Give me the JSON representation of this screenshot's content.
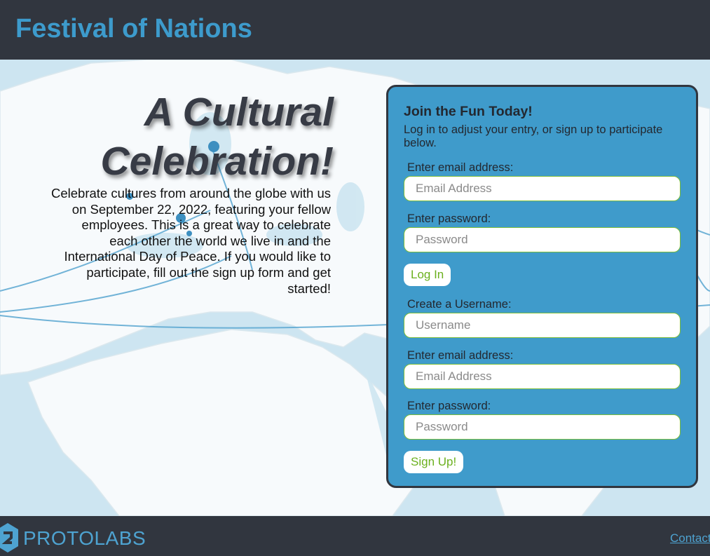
{
  "header": {
    "title": "Festival of Nations"
  },
  "hero": {
    "headline_line1": "A Cultural",
    "headline_line2": "Celebration!",
    "intro": "Celebrate cultures from around the globe with us on September 22, 2022, featuring your fellow employees. This is a great way to celebrate each other the world we live in and the International Day of Peace. If you would like to participate, fill out the sign up form and get started!"
  },
  "panel": {
    "title": "Join the Fun Today!",
    "subtitle": "Log in to adjust your entry, or sign up to participate below.",
    "login": {
      "email_label": "Enter email address:",
      "email_placeholder": "Email Address",
      "password_label": "Enter password:",
      "password_placeholder": "Password",
      "button": "Log In"
    },
    "signup": {
      "username_label": "Create a Username:",
      "username_placeholder": "Username",
      "email_label": "Enter email address:",
      "email_placeholder": "Email Address",
      "password_label": "Enter password:",
      "password_placeholder": "Password",
      "button": "Sign Up!"
    }
  },
  "footer": {
    "logo_text": "PROTOLABS",
    "contact_link": "Contact"
  },
  "colors": {
    "header_bg": "#31363f",
    "accent_blue": "#3f9bcb",
    "button_text_green": "#6bb01e"
  }
}
